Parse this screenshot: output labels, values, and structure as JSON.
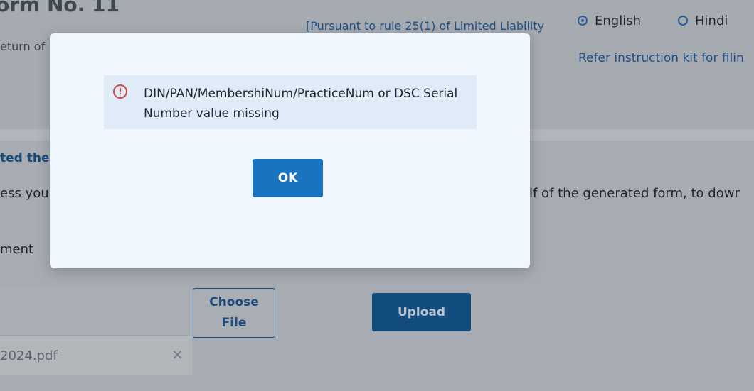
{
  "header": {
    "form_title": "orm No. 11",
    "subtitle": "eturn of",
    "pursuant_text": "[Pursuant to rule 25(1) of Limited Liability",
    "languages": [
      {
        "label": "English",
        "selected": true
      },
      {
        "label": "Hindi",
        "selected": false
      }
    ],
    "instruction_link": "Refer instruction kit for filin"
  },
  "main": {
    "section_heading": "ted the",
    "paragraph_left": "ess you",
    "paragraph_right": "lf of the generated form, to dowr",
    "attachment_label": "ment",
    "choose_file_label_line1": "Choose",
    "choose_file_label_line2": "File",
    "upload_label": "Upload",
    "attached_file_name": "2024.pdf",
    "remove_icon_glyph": "✕"
  },
  "modal": {
    "message": "DIN/PAN/MembershiNum/PracticeNum or DSC Serial Number value missing",
    "alert_icon_glyph": "!",
    "ok_label": "OK"
  },
  "colors": {
    "overlay_bg": "#a7acb3",
    "modal_bg": "#eff6fe",
    "alert_bg": "#e0ebf8",
    "alert_icon": "#d04848",
    "ok_button": "#1a73be",
    "upload_button": "#124b7e",
    "link_text": "#1e4f86"
  }
}
